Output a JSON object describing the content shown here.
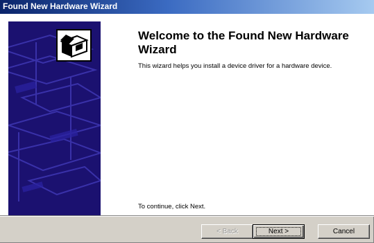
{
  "window": {
    "title": "Found New Hardware Wizard"
  },
  "main": {
    "heading": "Welcome to the Found New Hardware Wizard",
    "intro": "This wizard helps you install a device driver for a hardware device.",
    "continue_text": "To continue, click Next."
  },
  "buttons": {
    "back_label": "< Back",
    "next_label": "Next >",
    "cancel_label": "Cancel"
  },
  "icons": {
    "wizard": "hardware-install-icon"
  },
  "colors": {
    "title_bar": "#0a246a",
    "side_panel": "#1b1170",
    "dialog_face": "#d4d0c8"
  }
}
